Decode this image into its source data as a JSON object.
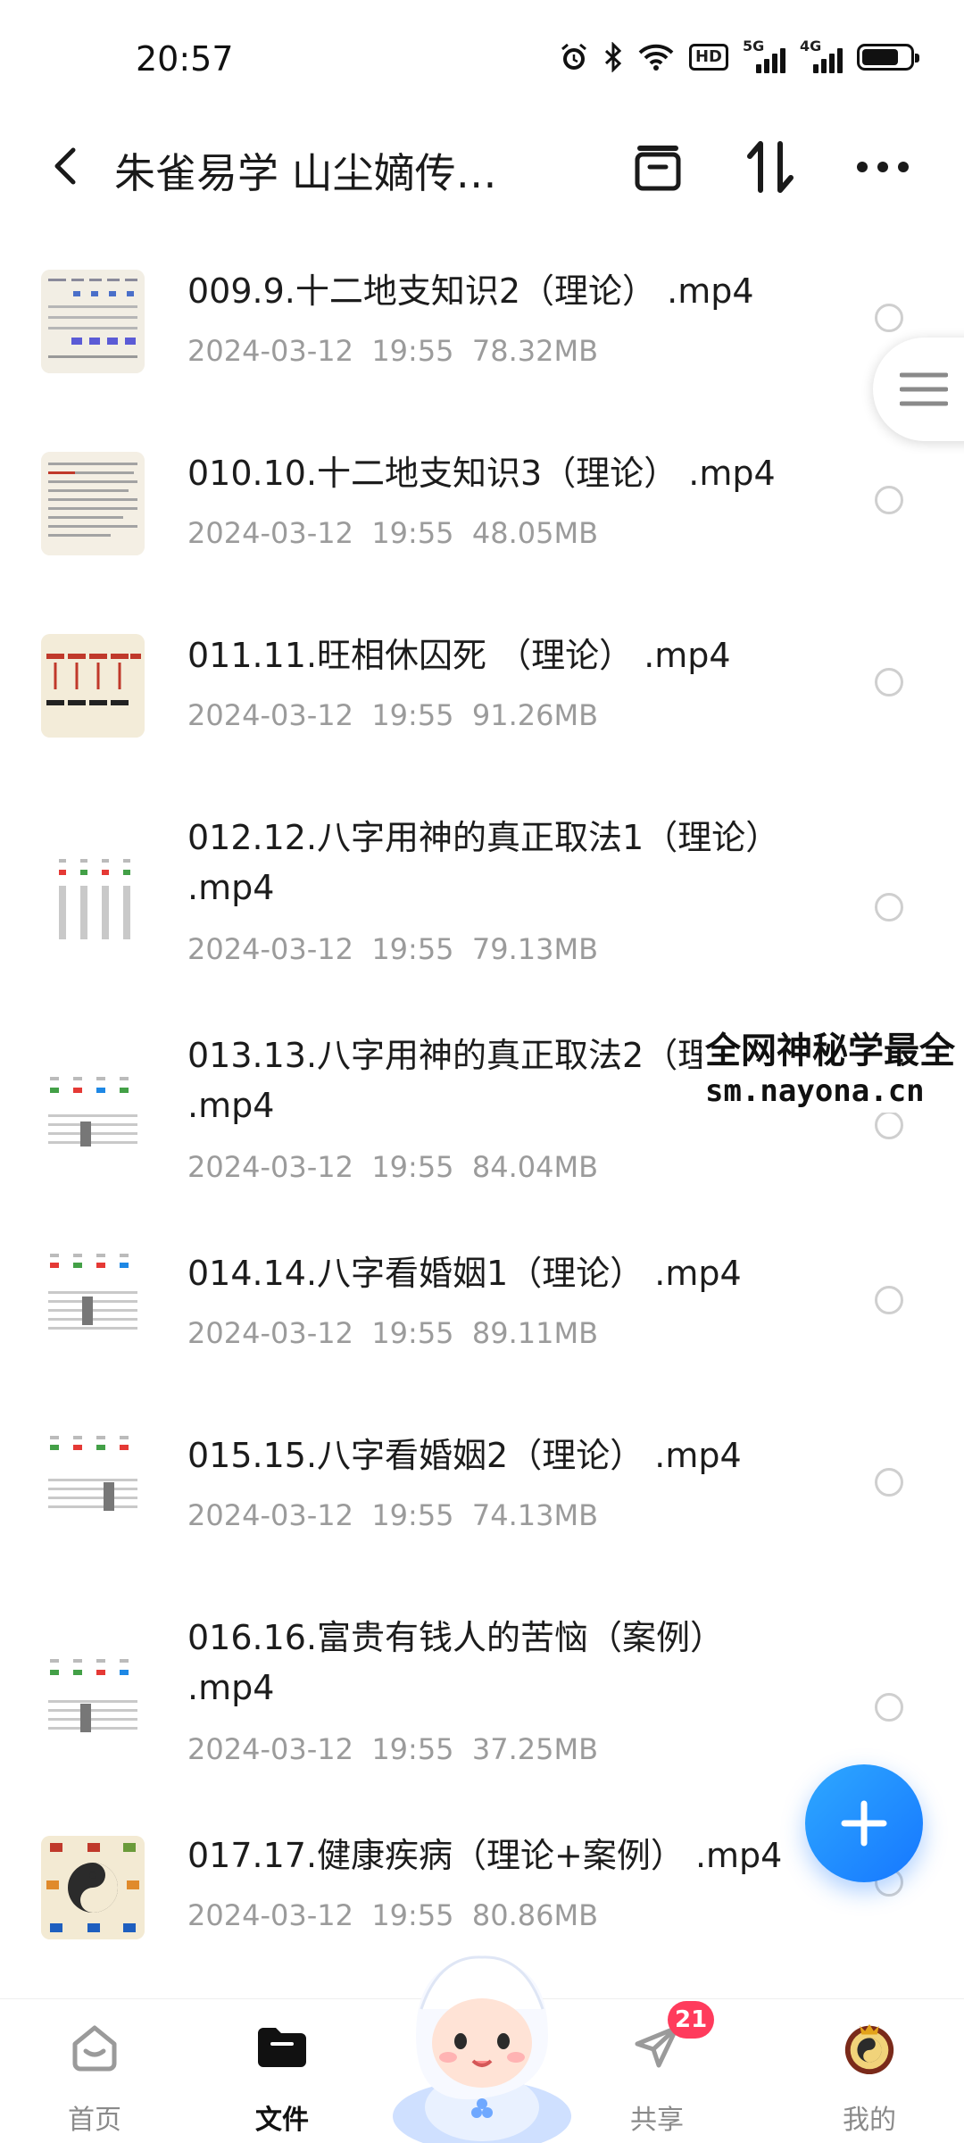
{
  "status_bar": {
    "time": "20:57",
    "icons": [
      "alarm-icon",
      "bluetooth-icon",
      "wifi-icon",
      "hd-icon",
      "5g-signal-icon",
      "4g-signal-icon",
      "battery-icon"
    ],
    "hd_label": "HD",
    "net1": "5G",
    "net2": "4G"
  },
  "header": {
    "title": "朱雀易学 山尘嫡传…",
    "icons": [
      "back-icon",
      "tray-icon",
      "sort-icon",
      "more-icon"
    ]
  },
  "files": [
    {
      "name": "009.9.十二地支知识2（理论） .mp4",
      "date": "2024-03-12",
      "time": "19:55",
      "size": "78.32MB",
      "thumb": "doc-table"
    },
    {
      "name": "010.10.十二地支知识3（理论） .mp4",
      "date": "2024-03-12",
      "time": "19:55",
      "size": "48.05MB",
      "thumb": "doc-text"
    },
    {
      "name": "011.11.旺相休囚死 （理论） .mp4",
      "date": "2024-03-12",
      "time": "19:55",
      "size": "91.26MB",
      "thumb": "slide-red"
    },
    {
      "name": "012.12.八字用神的真正取法1（理论） .mp4",
      "date": "2024-03-12",
      "time": "19:55",
      "size": "79.13MB",
      "thumb": "chart-columns"
    },
    {
      "name": "013.13.八字用神的真正取法2（理论） .mp4",
      "date": "2024-03-12",
      "time": "19:55",
      "size": "84.04MB",
      "thumb": "chart-columns-2"
    },
    {
      "name": "014.14.八字看婚姻1（理论） .mp4",
      "date": "2024-03-12",
      "time": "19:55",
      "size": "89.11MB",
      "thumb": "chart-columns-3"
    },
    {
      "name": "015.15.八字看婚姻2（理论） .mp4",
      "date": "2024-03-12",
      "time": "19:55",
      "size": "74.13MB",
      "thumb": "chart-columns-4"
    },
    {
      "name": "016.16.富贵有钱人的苦恼（案例） .mp4",
      "date": "2024-03-12",
      "time": "19:55",
      "size": "37.25MB",
      "thumb": "chart-columns-5"
    },
    {
      "name": "017.17.健康疾病（理论+案例） .mp4",
      "date": "2024-03-12",
      "time": "19:55",
      "size": "80.86MB",
      "thumb": "yin-yang"
    }
  ],
  "watermark": {
    "line1": "全网神秘学最全",
    "line2": "sm.nayona.cn"
  },
  "fab": {
    "icon": "plus-icon"
  },
  "bottom_nav": [
    {
      "label": "首页",
      "icon": "home-icon",
      "active": false
    },
    {
      "label": "文件",
      "icon": "folder-icon",
      "active": true
    },
    {
      "label": "",
      "icon": "mascot-icon",
      "active": false
    },
    {
      "label": "共享",
      "icon": "paper-plane-icon",
      "active": false,
      "badge": "21"
    },
    {
      "label": "我的",
      "icon": "avatar-icon",
      "active": false
    }
  ],
  "colors": {
    "accent": "#1677ff",
    "badge": "#ff3b5c",
    "meta": "#9b9b9b"
  }
}
